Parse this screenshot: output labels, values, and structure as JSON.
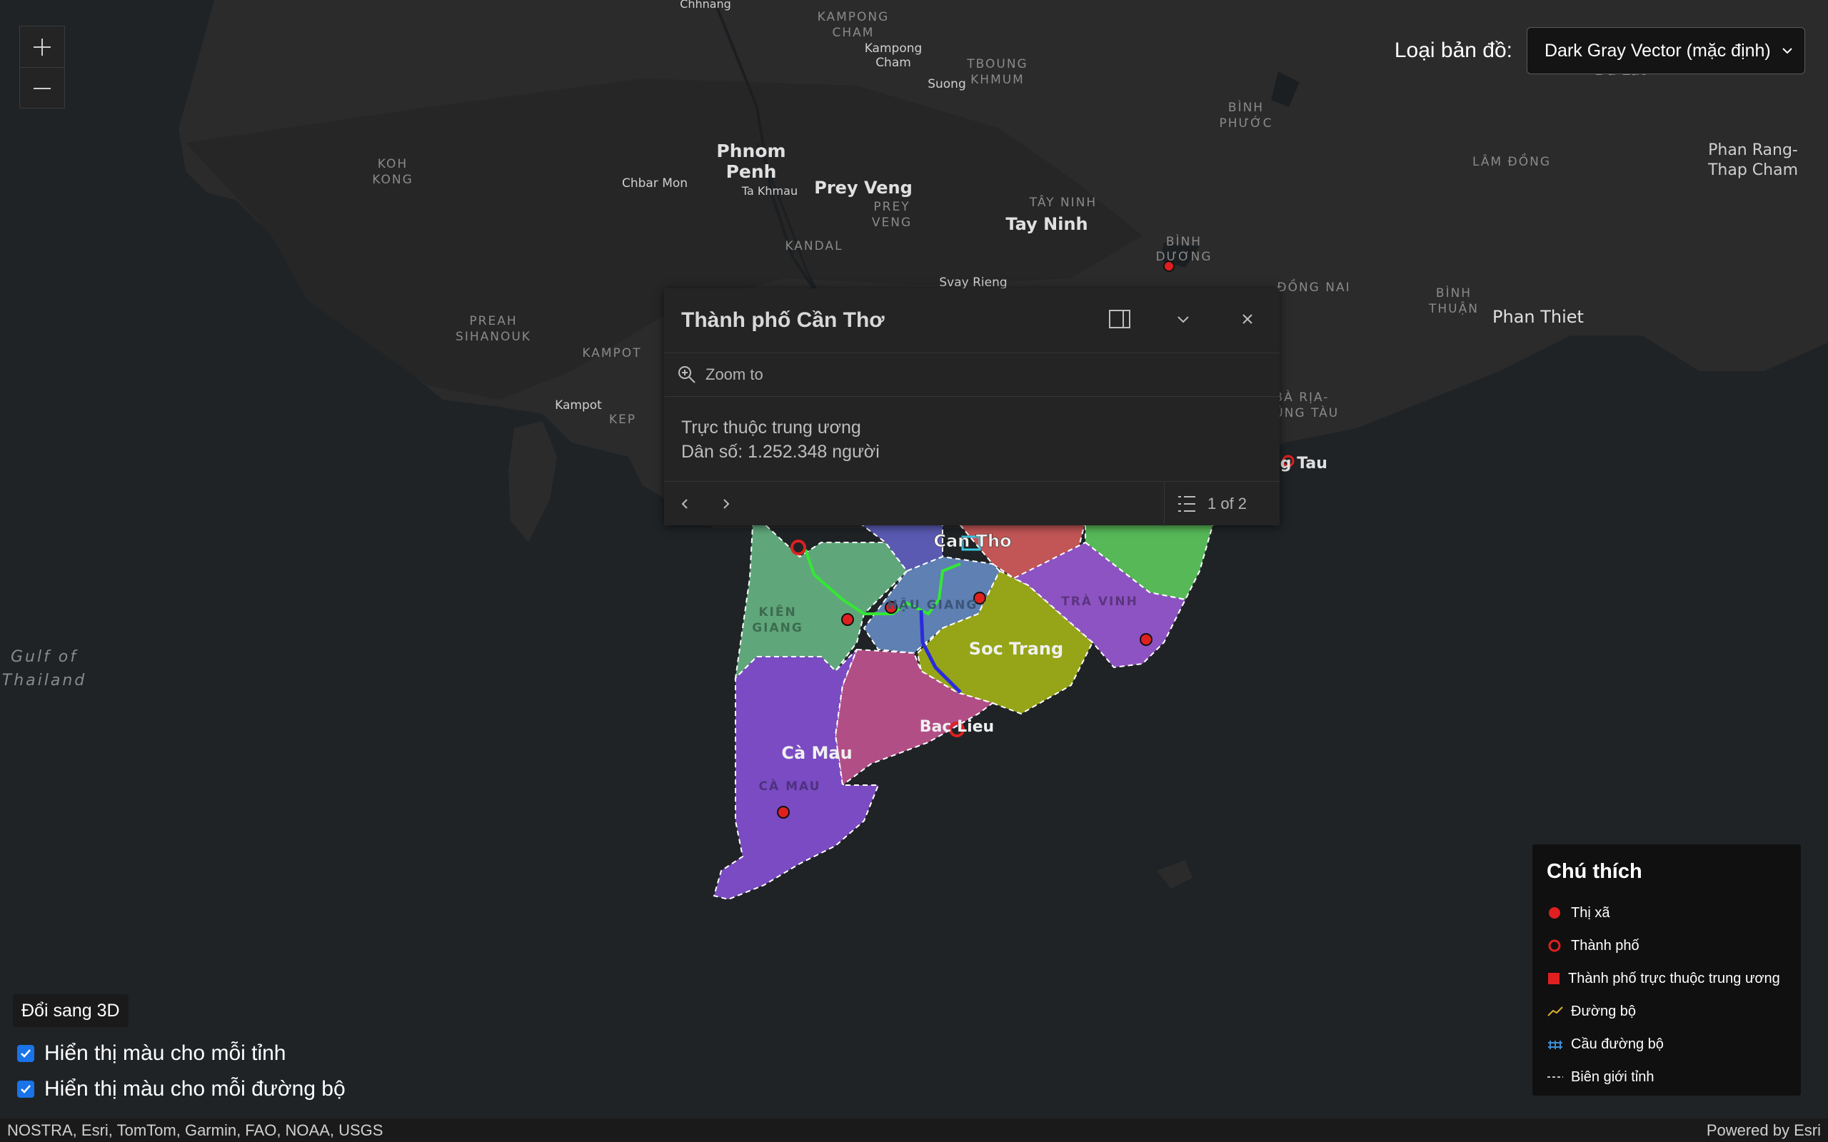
{
  "map": {
    "zoom_in_label": "+",
    "zoom_out_label": "−",
    "basemap_label": "Loại bản đồ:",
    "basemap_value": "Dark Gray Vector (mặc định)",
    "labels": {
      "chhnang": "Chhnang",
      "kampong_cham_prov_1": "KAMPONG",
      "kampong_cham_prov_2": "CHAM",
      "kampong_cham_1": "Kampong",
      "kampong_cham_2": "Cham",
      "tboung_khmum_1": "TBOUNG",
      "tboung_khmum_2": "KHMUM",
      "suong": "Suong",
      "da_lat": "Da Lat",
      "binh_phuoc_1": "BÌNH",
      "binh_phuoc_2": "PHƯỚC",
      "lam_dong": "LÂM ĐỒNG",
      "phan_rang_1": "Phan Rang-",
      "phan_rang_2": "Thap Cham",
      "koh_kong_1": "KOH",
      "koh_kong_2": "KONG",
      "phnom_penh_1": "Phnom",
      "phnom_penh_2": "Penh",
      "chbar_mon": "Chbar Mon",
      "ta_khmau": "Ta Khmau",
      "prey_veng": "Prey Veng",
      "prey_veng_prov_1": "PREY",
      "prey_veng_prov_2": "VENG",
      "tay_ninh_prov": "TÂY NINH",
      "tay_ninh": "Tay Ninh",
      "binh_duong_1": "BÌNH",
      "binh_duong_2": "DƯƠNG",
      "kandal": "KANDAL",
      "svay_rieng": "Svay Rieng",
      "dong_nai": "ĐỒNG NAI",
      "binh_thuan_1": "BÌNH",
      "binh_thuan_2": "THUẬN",
      "phan_thiet": "Phan Thiet",
      "preah_sihanouk_1": "PREAH",
      "preah_sihanouk_2": "SIHANOUK",
      "kampot_prov": "KAMPOT",
      "kampot": "Kampot",
      "kep": "KEP",
      "ba_ria_1": "BÀ RỊA-",
      "ba_ria_2": "VŨNG TÀU",
      "vung_tau": "ng Tau",
      "gulf_1": "Gulf of",
      "gulf_2": "Thailand",
      "can_tho": "Can Tho",
      "kien_giang_1": "KIÊN",
      "kien_giang_2": "GIANG",
      "hau_giang": "HẬU GIANG",
      "soc_trang": "Soc Trang",
      "tra_vinh": "TRÀ VINH",
      "bac_lieu": "Bac Lieu",
      "ca_mau_city": "Cà Mau",
      "ca_mau_prov": "CÀ MAU"
    }
  },
  "popup": {
    "title": "Thành phố Cần Thơ",
    "zoom_to": "Zoom to",
    "line1": "Trực thuộc trung ương",
    "line2": "Dân số: 1.252.348 người",
    "pager": "1 of 2"
  },
  "legend": {
    "title": "Chú thích",
    "items": [
      "Thị xã",
      "Thành phố",
      "Thành phố trực thuộc trung ương",
      "Đường bộ",
      "Cầu đường bộ",
      "Biên giới tỉnh"
    ]
  },
  "controls": {
    "toggle_3d": "Đổi sang 3D",
    "check_province_colors": "Hiển thị màu cho mỗi tỉnh",
    "check_road_colors": "Hiển thị màu cho mỗi đường bộ",
    "check_province_checked": true,
    "check_road_checked": true
  },
  "attribution": {
    "sources": "NOSTRA, Esri, TomTom, Garmin, FAO, NOAA, USGS",
    "powered_by": "Powered by Esri"
  },
  "colors": {
    "land": "#2c2c2c",
    "water": "#1e2226",
    "kien_giang": "#5fa77b",
    "hau_giang": "#5e80b2",
    "soc_trang": "#96a517",
    "tra_vinh": "#8e53c3",
    "bac_lieu": "#b24e86",
    "ca_mau": "#7a4bc2",
    "marker": "#e02020"
  }
}
